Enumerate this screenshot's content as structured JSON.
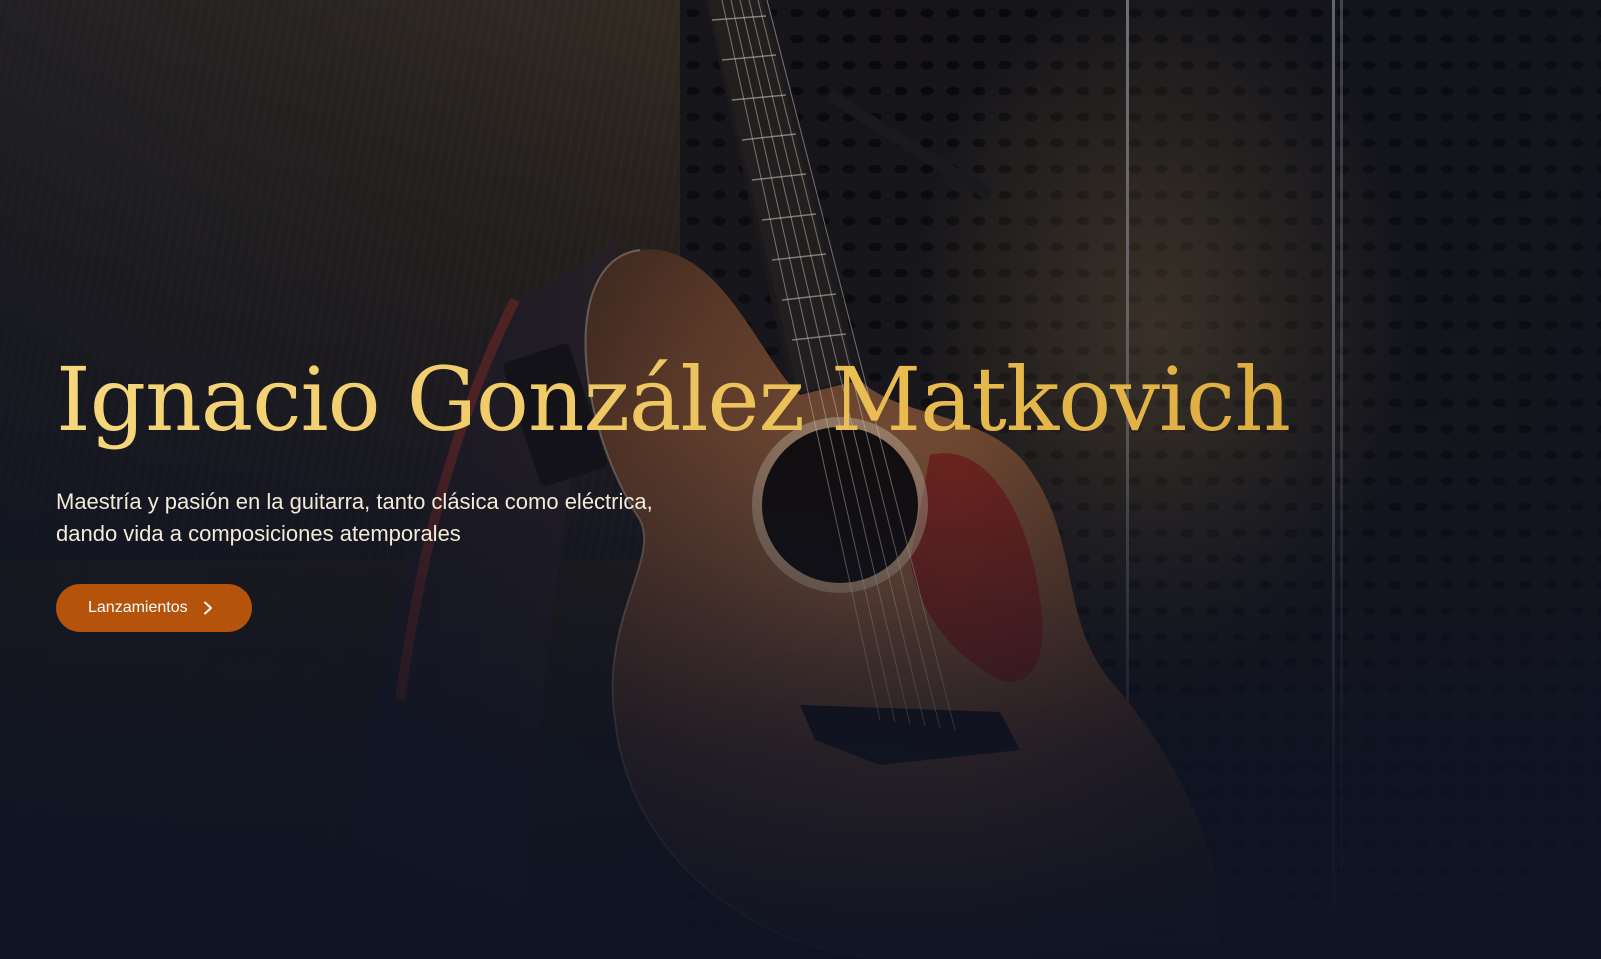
{
  "hero": {
    "title": "Ignacio González Matkovich",
    "subtitle": "Maestría y pasión en la guitarra, tanto clásica como eléctrica, dando vida a composiciones atemporales",
    "cta": {
      "label": "Lanzamientos",
      "icon": "chevron-right-icon"
    },
    "background_image": "acoustic-guitar-photo"
  },
  "colors": {
    "background": "#0f1424",
    "title_gold": "#efc962",
    "subtitle_text": "#f3ead7",
    "cta_background": "#b5520c",
    "cta_text": "#ffffff"
  }
}
